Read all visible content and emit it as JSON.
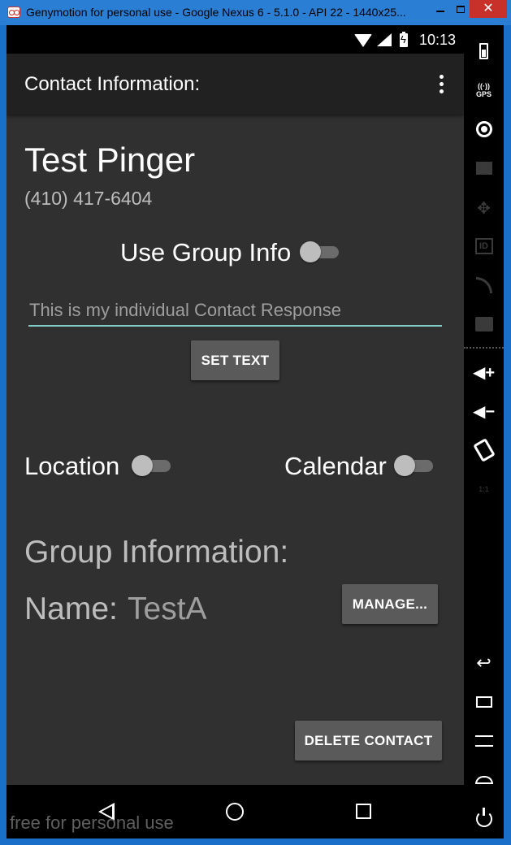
{
  "window": {
    "title": "Genymotion for personal use - Google Nexus 6 - 5.1.0 - API 22 - 1440x25...",
    "close_label": "✕"
  },
  "status_bar": {
    "time": "10:13"
  },
  "app_bar": {
    "title": "Contact Information:"
  },
  "contact": {
    "name": "Test Pinger",
    "phone": "(410) 417-6404"
  },
  "use_group_info": {
    "label": "Use Group Info",
    "checked": false
  },
  "response_field": {
    "placeholder": "This is my individual Contact Response"
  },
  "set_text_button": "SET TEXT",
  "location": {
    "label": "Location",
    "checked": false
  },
  "calendar": {
    "label": "Calendar",
    "checked": false
  },
  "group": {
    "title": "Group Information:",
    "name_label": "Name:",
    "name_value": "TestA",
    "manage_button": "MANAGE..."
  },
  "delete_button": "DELETE CONTACT",
  "watermark": "free for personal use",
  "toolbar": {
    "gps_label": "GPS",
    "id_label": "ID",
    "vol_up": "◀+",
    "vol_down": "◀−",
    "scale_label": "1:1",
    "back_glyph": "↩"
  },
  "colors": {
    "accent": "#80cbc4",
    "background": "#303030",
    "app_bar": "#212121",
    "button": "#5a5a5a",
    "window_frame": "#1a6fc9"
  }
}
